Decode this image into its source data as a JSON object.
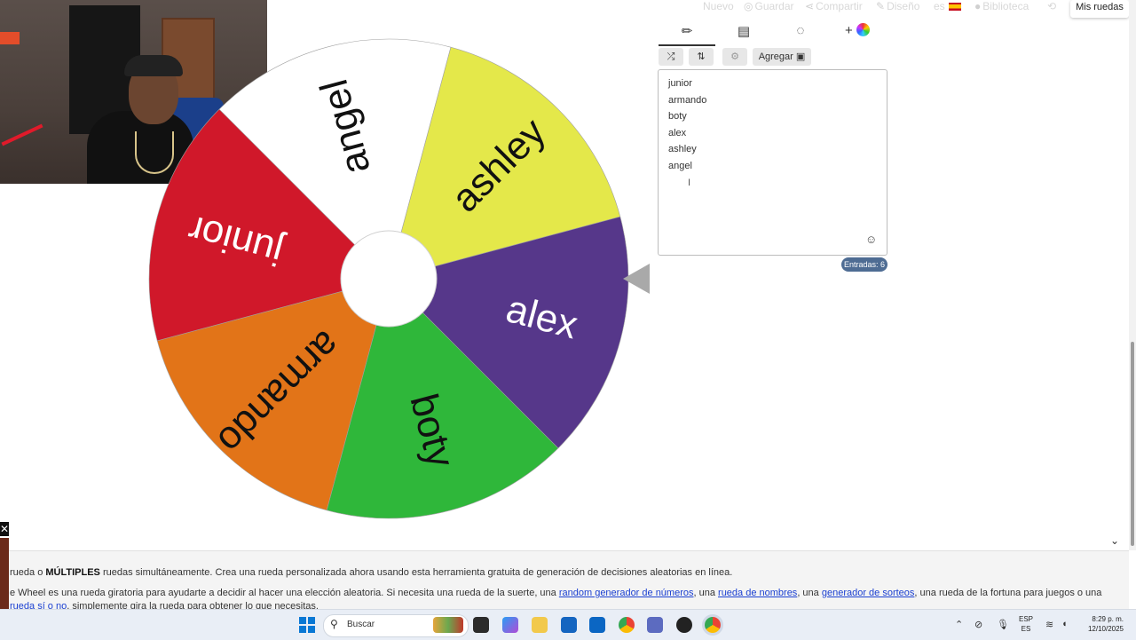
{
  "nav": {
    "items": [
      {
        "label": "Nuevo",
        "icon": ""
      },
      {
        "label": "Guardar",
        "icon": "save-icon"
      },
      {
        "label": "Compartir",
        "icon": "share-icon"
      },
      {
        "label": "Diseño",
        "icon": "palette-icon"
      },
      {
        "label": "es",
        "icon": "spain-flag-icon"
      },
      {
        "label": "Biblioteca",
        "icon": "globe-icon"
      }
    ],
    "account_button": "Mis ruedas"
  },
  "wheel": {
    "segments": [
      {
        "label": "ashley",
        "color": "#e4e84a"
      },
      {
        "label": "alex",
        "color": "#56378a"
      },
      {
        "label": "boty",
        "color": "#2fb73a"
      },
      {
        "label": "armando",
        "color": "#e27418"
      },
      {
        "label": "junior",
        "color": "#d0182a"
      },
      {
        "label": "angel",
        "color": "#ffffff"
      }
    ]
  },
  "editor": {
    "toolbar": {
      "add_image_label": "Agregar"
    },
    "entries": [
      "junior",
      "armando",
      "boty",
      "alex",
      "ashley",
      "angel"
    ],
    "entries_count": "Entradas: 6"
  },
  "bottom": {
    "line1_prefix": "rueda o ",
    "line1_bold": "MÚLTIPLES",
    "line1_rest": " ruedas simultáneamente. Crea una rueda personalizada ahora usando esta herramienta gratuita de generación de decisiones aleatorias en línea.",
    "line2_a": "e Wheel es una rueda giratoria para ayudarte a decidir al hacer una elección aleatoria. Si necesita una rueda de la suerte, una ",
    "link1": "random generador de números",
    "line2_b": ", una ",
    "link2": "rueda de nombres",
    "line2_c": ", una ",
    "link3": "generador de sorteos",
    "line2_d": ", una rueda de la fortuna para juegos o una",
    "link4": "rueda sí o no",
    "line3_rest": ", simplemente gira la rueda para obtener lo que necesitas."
  },
  "taskbar": {
    "search_placeholder": "Buscar",
    "lang_top": "ESP",
    "lang_bottom": "ES",
    "time": "8:29 p. m.",
    "date": "12/10/2025"
  }
}
